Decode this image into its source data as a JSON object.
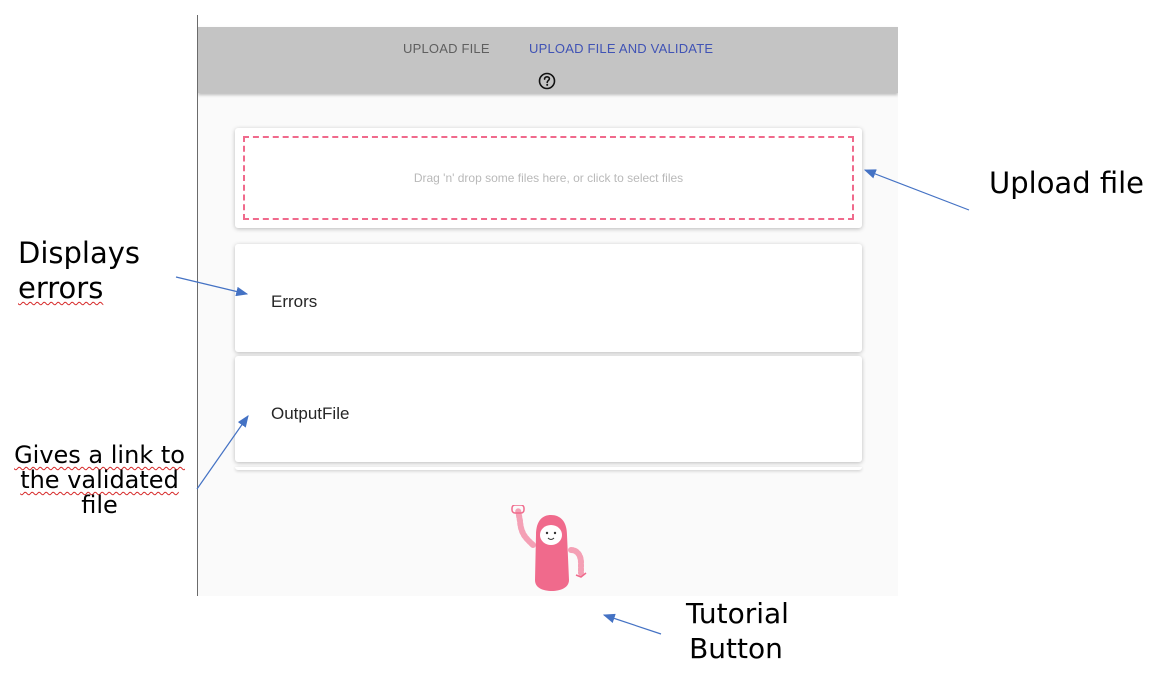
{
  "tabs": [
    {
      "label": "UPLOAD FILE",
      "active": false
    },
    {
      "label": "UPLOAD FILE AND VALIDATE",
      "active": true
    }
  ],
  "help_icon": "help-circle-icon",
  "dropzone": {
    "text": "Drag 'n' drop some files here, or click to select files"
  },
  "errors_card": {
    "label": "Errors"
  },
  "output_card": {
    "label": "OutputFile"
  },
  "tutorial_button": {
    "icon": "robot-mascot-icon"
  },
  "annotations": {
    "upload": "Upload file",
    "errors_line1": "Displays",
    "errors_line2": "errors",
    "link_line1": "Gives a link to",
    "link_line2": "the validated",
    "link_line3": "file",
    "tutorial_line1": "Tutorial",
    "tutorial_line2": "Button"
  },
  "colors": {
    "tabbar_bg": "#c4c4c4",
    "active_tab": "#4053b5",
    "inactive_tab": "#5f5f5f",
    "dropzone_border": "#f06a8c",
    "robot": "#f06a8c",
    "arrow": "#4472c4"
  }
}
